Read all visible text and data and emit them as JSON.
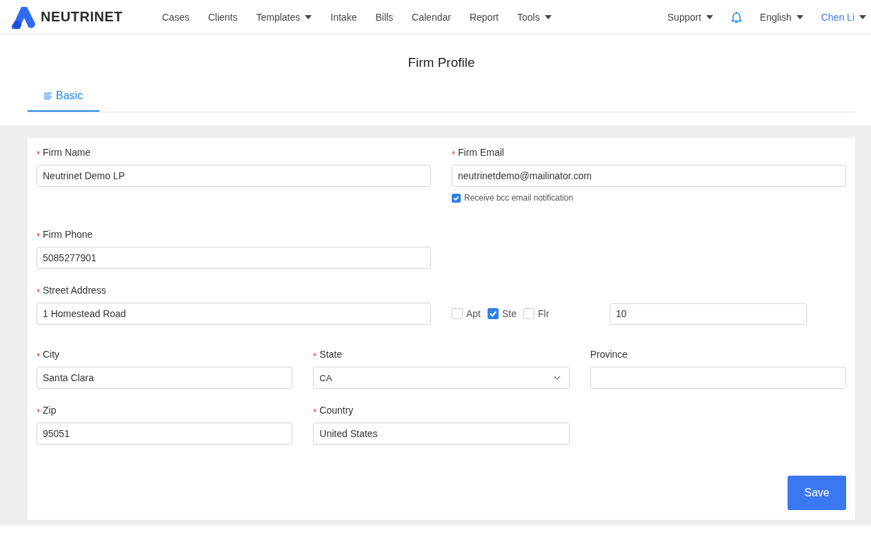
{
  "brand": "NEUTRINET",
  "nav": [
    {
      "label": "Cases",
      "dropdown": false
    },
    {
      "label": "Clients",
      "dropdown": false
    },
    {
      "label": "Templates",
      "dropdown": true
    },
    {
      "label": "Intake",
      "dropdown": false
    },
    {
      "label": "Bills",
      "dropdown": false
    },
    {
      "label": "Calendar",
      "dropdown": false
    },
    {
      "label": "Report",
      "dropdown": false
    },
    {
      "label": "Tools",
      "dropdown": true
    }
  ],
  "support": "Support",
  "language": "English",
  "user": "Chen Li",
  "page_title": "Firm Profile",
  "tabs": [
    {
      "label": "Basic",
      "selected": true
    }
  ],
  "fields": {
    "firm_name": {
      "label": "Firm Name",
      "required": true,
      "value": "Neutrinet Demo LP"
    },
    "firm_email": {
      "label": "Firm Email",
      "required": true,
      "value": "neutrinetdemo@mailinator.com"
    },
    "bcc": {
      "label": "Receive bcc email notification",
      "checked": true
    },
    "firm_phone": {
      "label": "Firm Phone",
      "required": true,
      "value": "5085277901"
    },
    "street": {
      "label": "Street Address",
      "required": true,
      "value": "1 Homestead Road"
    },
    "unit_types": [
      {
        "label": "Apt",
        "checked": false
      },
      {
        "label": "Ste",
        "checked": true
      },
      {
        "label": "Flr",
        "checked": false
      }
    ],
    "unit": {
      "value": "10"
    },
    "city": {
      "label": "City",
      "required": true,
      "value": "Santa Clara"
    },
    "state": {
      "label": "State",
      "required": true,
      "value": "CA"
    },
    "province": {
      "label": "Province",
      "required": false
    },
    "zip": {
      "label": "Zip",
      "required": true,
      "value": "95051"
    },
    "country": {
      "label": "Country",
      "required": true,
      "value": "United States"
    }
  },
  "save": "Save"
}
